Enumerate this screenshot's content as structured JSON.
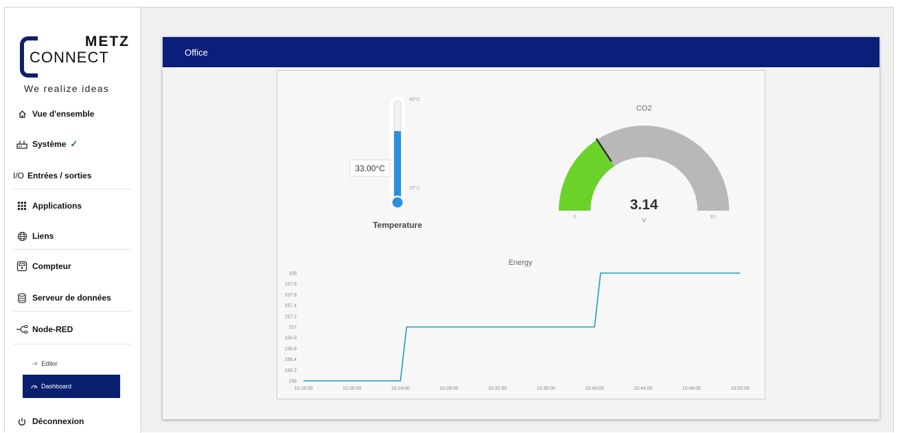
{
  "brand": {
    "line1": "METZ",
    "line2": "CONNECT",
    "tagline": "We realize ideas"
  },
  "nav": {
    "overview": "Vue d'ensemble",
    "system": "Système",
    "io": "Entrées / sorties",
    "applications": "Applications",
    "links": "Liens",
    "meter": "Compteur",
    "data_server": "Serveur de données",
    "nodered": "Node-RED",
    "editor": "Editor",
    "dashboard": "Dashboard",
    "logout": "Déconnexion",
    "io_prefix": "I/O",
    "system_status": "✓"
  },
  "header": {
    "title": "Office"
  },
  "thermometer": {
    "label": "Temperature",
    "value_text": "33.00°C",
    "value": 33,
    "max_label": "40°C",
    "min_label": "20°C",
    "fill_color": "#2b8fe0"
  },
  "gauge": {
    "title": "CO2",
    "value": 3.14,
    "value_text": "3.14",
    "unit": "V",
    "min": 0,
    "max": 10,
    "min_label": "0",
    "max_label": "10",
    "fill_color": "#6bd22a",
    "track_color": "#b8b8b8"
  },
  "chart_data": {
    "type": "line",
    "title": "Energy",
    "x_ticks": [
      "10:16:00",
      "10:20:00",
      "10:24:00",
      "10:28:00",
      "10:32:00",
      "10:36:00",
      "10:40:00",
      "10:44:00",
      "10:48:00",
      "10:52:00"
    ],
    "y_ticks": [
      "156",
      "156.2",
      "156.4",
      "156.6",
      "156.8",
      "157",
      "157.2",
      "157.4",
      "157.6",
      "157.8",
      "158"
    ],
    "ylim": [
      156,
      158
    ],
    "xlim": [
      "10:16:00",
      "10:52:00"
    ],
    "series": [
      {
        "color": "#1f9bbd",
        "points": [
          [
            "10:16:00",
            156
          ],
          [
            "10:24:00",
            156
          ],
          [
            "10:24:30",
            157
          ],
          [
            "10:40:00",
            157
          ],
          [
            "10:40:30",
            158
          ],
          [
            "10:52:00",
            158
          ]
        ]
      }
    ]
  }
}
